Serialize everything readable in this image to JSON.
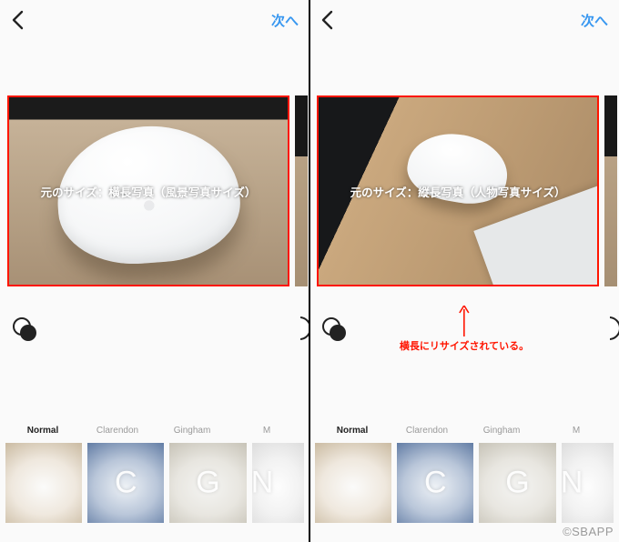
{
  "nav": {
    "next_label": "次へ"
  },
  "left": {
    "overlay_text": "元のサイズ：横長写真（風景写真サイズ）",
    "filters": [
      {
        "label": "Normal",
        "selected": true,
        "letter": ""
      },
      {
        "label": "Clarendon",
        "selected": false,
        "letter": "C"
      },
      {
        "label": "Gingham",
        "selected": false,
        "letter": "G"
      },
      {
        "label": "M",
        "selected": false,
        "letter": "N"
      }
    ]
  },
  "right": {
    "overlay_text": "元のサイズ：縦長写真（人物写真サイズ）",
    "annotation": "横長にリサイズされている。",
    "filters": [
      {
        "label": "Normal",
        "selected": true,
        "letter": ""
      },
      {
        "label": "Clarendon",
        "selected": false,
        "letter": "C"
      },
      {
        "label": "Gingham",
        "selected": false,
        "letter": "G"
      },
      {
        "label": "M",
        "selected": false,
        "letter": "N"
      }
    ]
  },
  "watermark": "©SBAPP"
}
